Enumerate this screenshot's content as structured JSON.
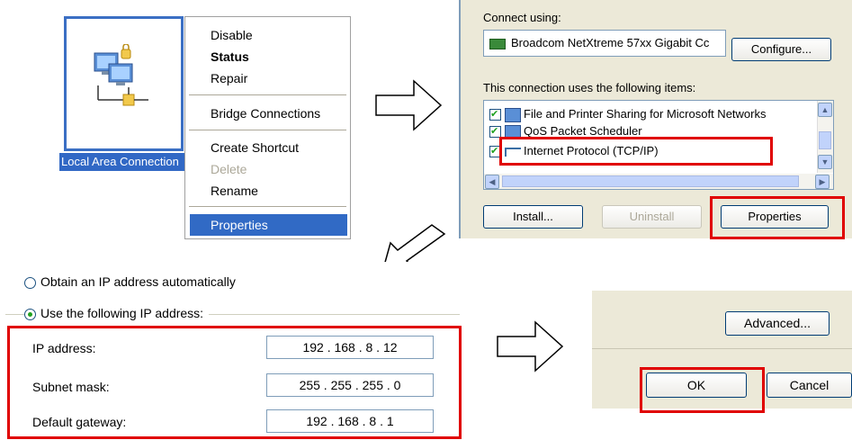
{
  "desktop_icon": {
    "caption": "Local Area Connection"
  },
  "context_menu": {
    "items": [
      {
        "label": "Disable"
      },
      {
        "label": "Status"
      },
      {
        "label": "Repair"
      },
      {
        "label": "Bridge Connections"
      },
      {
        "label": "Create Shortcut"
      },
      {
        "label": "Delete"
      },
      {
        "label": "Rename"
      },
      {
        "label": "Properties"
      }
    ]
  },
  "connection_properties": {
    "connect_using_label": "Connect using:",
    "adapter_name": "Broadcom NetXtreme 57xx Gigabit Cc",
    "configure_button": "Configure...",
    "items_label": "This connection uses the following items:",
    "items": [
      {
        "label": "File and Printer Sharing for Microsoft Networks",
        "checked": true
      },
      {
        "label": "QoS Packet Scheduler",
        "checked": true
      },
      {
        "label": "Internet Protocol (TCP/IP)",
        "checked": true
      }
    ],
    "install_button": "Install...",
    "uninstall_button": "Uninstall",
    "properties_button": "Properties"
  },
  "ip_settings": {
    "obtain_auto_label": "Obtain an IP address automatically",
    "use_following_label": "Use the following IP address:",
    "fields": [
      {
        "label": "IP address:",
        "value": "192 . 168 .  8  . 12"
      },
      {
        "label": "Subnet mask:",
        "value": "255 . 255 . 255 .  0"
      },
      {
        "label": "Default gateway:",
        "value": "192 . 168 .  8  .  1"
      }
    ]
  },
  "dialog_buttons": {
    "advanced_button": "Advanced...",
    "ok_button": "OK",
    "cancel_button": "Cancel"
  },
  "colors": {
    "highlight_red": "#e00000",
    "selection_blue": "#316ac5",
    "dialog_bg": "#ece9d8"
  }
}
